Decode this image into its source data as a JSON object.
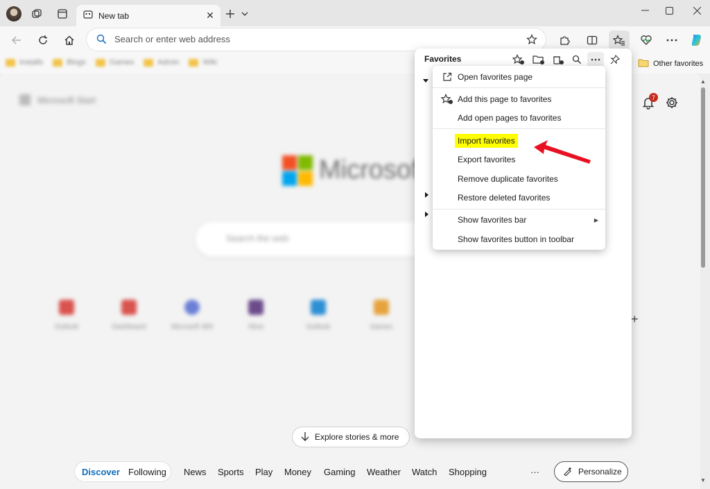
{
  "tab": {
    "title": "New tab",
    "close": "✕"
  },
  "address": {
    "placeholder": "Search or enter web address"
  },
  "favorites_bar": {
    "blurred_items": [
      "Installs",
      "Blogs",
      "Games",
      "Admin",
      "Wiki"
    ],
    "other_favorites": "Other favorites"
  },
  "panel": {
    "title": "Favorites"
  },
  "menu": {
    "items": [
      {
        "label": "Open favorites page"
      },
      {
        "label": "Add this page to favorites"
      },
      {
        "label": "Add open pages to favorites"
      },
      {
        "label": "Import favorites"
      },
      {
        "label": "Export favorites"
      },
      {
        "label": "Remove duplicate favorites"
      },
      {
        "label": "Restore deleted favorites"
      },
      {
        "label": "Show favorites bar"
      },
      {
        "label": "Show favorites button in toolbar"
      }
    ]
  },
  "page": {
    "start_label": "Microsoft Start",
    "ms_word": "Microsoft",
    "web_search_placeholder": "Search the web",
    "quick_links": [
      "Outlook",
      "Dashboard",
      "Microsoft 365",
      "Xbox",
      "Outlook",
      "Games"
    ],
    "explore": "Explore stories & more",
    "notification_count": "7",
    "personalize": "Personalize",
    "nav": {
      "discover": "Discover",
      "following": "Following",
      "items": [
        "News",
        "Sports",
        "Play",
        "Money",
        "Gaming",
        "Weather",
        "Watch",
        "Shopping"
      ],
      "more": "···"
    }
  },
  "colors": {
    "highlight": "#ffff00",
    "arrow": "#e81123",
    "accent": "#0f6cbd",
    "badge": "#c42b1c"
  }
}
